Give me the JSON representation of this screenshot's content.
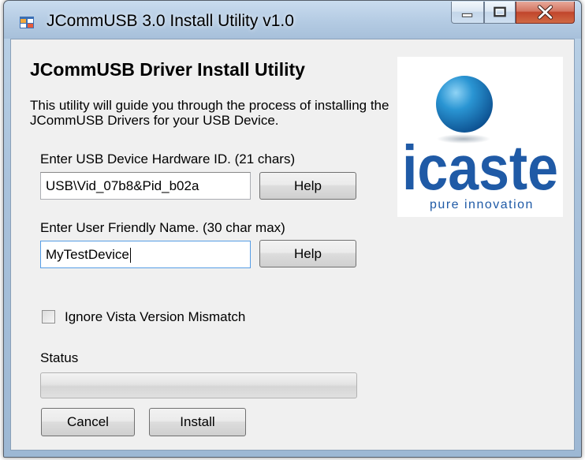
{
  "window": {
    "title": "JCommUSB 3.0 Install Utility v1.0"
  },
  "content": {
    "heading": "JCommUSB Driver Install Utility",
    "description": "This utility will guide you through the process of installing the JCommUSB Drivers for your USB Device.",
    "hardware_id": {
      "label": "Enter USB Device Hardware ID. (21 chars)",
      "value": "USB\\Vid_07b8&Pid_b02a",
      "help_label": "Help"
    },
    "friendly_name": {
      "label": "Enter User Friendly Name. (30 char max)",
      "value": "MyTestDevice",
      "help_label": "Help"
    },
    "ignore_mismatch": {
      "label": "Ignore Vista Version Mismatch",
      "checked": false
    },
    "status": {
      "label": "Status",
      "progress": 0
    },
    "buttons": {
      "cancel": "Cancel",
      "install": "Install"
    }
  },
  "logo": {
    "wordmark": "icaste",
    "tagline": "pure innovation",
    "icon": "blue-sphere-logo"
  },
  "colors": {
    "logo_blue": "#1f5aa6",
    "sphere_blue": "#1a82c4",
    "close_red": "#c1452b"
  }
}
